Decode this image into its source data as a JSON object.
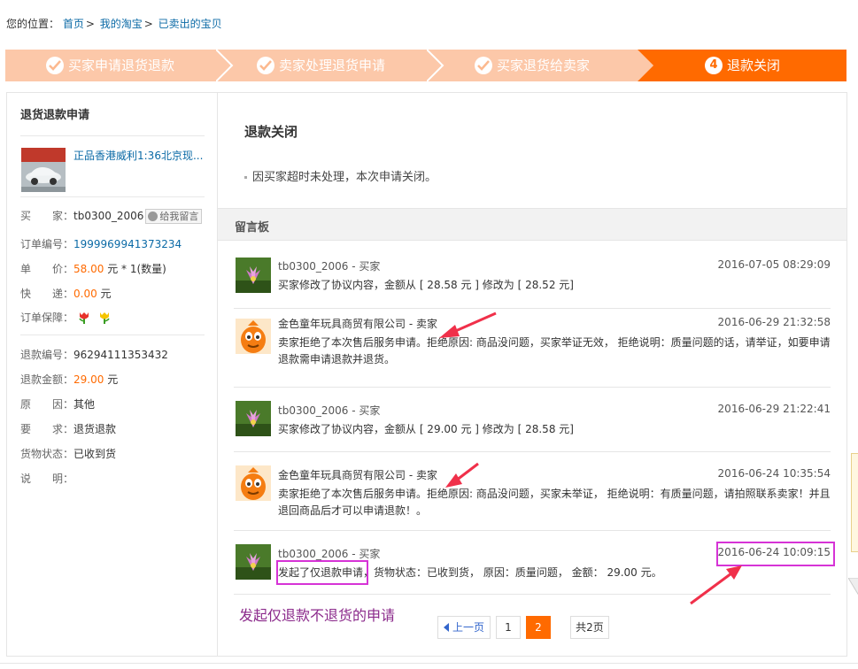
{
  "breadcrumb": {
    "prefix": "您的位置：",
    "items": [
      "首页",
      "我的淘宝",
      "已卖出的宝贝"
    ],
    "sep": ">"
  },
  "steps": [
    {
      "label": "买家申请退货退款",
      "state": "done"
    },
    {
      "label": "卖家处理退货申请",
      "state": "done"
    },
    {
      "label": "买家退货给卖家",
      "state": "done"
    },
    {
      "label": "退款关闭",
      "state": "current",
      "number": "4"
    }
  ],
  "colors": {
    "step_done": "#fcc8a9",
    "step_current": "#ff6a00",
    "accent": "#ff6a00",
    "annotation": "#d633d6"
  },
  "sidebar": {
    "title": "退货退款申请",
    "product_link": "正品香港威利1:36北京现...",
    "buyer_label": "买　　家：",
    "buyer": "tb0300_2006",
    "msg_button": "给我留言",
    "order_no_label": "订单编号：",
    "order_no": "1999969941373234",
    "price_label": "单　　价：",
    "price": "58.00",
    "price_suffix": "元 * 1(数量)",
    "shipping_label": "快　　递：",
    "shipping": "0.00",
    "shipping_suffix": "元",
    "guarantee_label": "订单保障：",
    "refund_no_label": "退款编号：",
    "refund_no": "96294111353432",
    "refund_amount_label": "退款金额：",
    "refund_amount": "29.00",
    "refund_amount_suffix": "元",
    "reason_label": "原　　因：",
    "reason": "其他",
    "request_label": "要　　求：",
    "request": "退货退款",
    "goods_status_label": "货物状态：",
    "goods_status": "已收到货",
    "note_label": "说　　明："
  },
  "status": {
    "title": "退款关闭",
    "note": "因买家超时未处理，本次申请关闭。"
  },
  "board": {
    "title": "留言板",
    "messages": [
      {
        "who": "tb0300_2006 - 买家",
        "time": "2016-07-05 08:29:09",
        "text": "买家修改了协议内容，金额从 [ 28.58 元 ] 修改为 [ 28.52 元]",
        "avatar": "lotus-avatar"
      },
      {
        "who": "金色童年玩具商贸有限公司 - 卖家",
        "time": "2016-06-29 21:32:58",
        "text": "卖家拒绝了本次售后服务申请。拒绝原因: 商品没问题，买家举证无效， 拒绝说明：质量问题的话，请举证，如要申请退款需申请退款并退货。",
        "avatar": "mascot-avatar"
      },
      {
        "who": "tb0300_2006 - 买家",
        "time": "2016-06-29 21:22:41",
        "text": "买家修改了协议内容，金额从 [ 29.00 元 ] 修改为 [ 28.58 元]",
        "avatar": "lotus-avatar"
      },
      {
        "who": "金色童年玩具商贸有限公司 - 卖家",
        "time": "2016-06-24 10:35:54",
        "text": "卖家拒绝了本次售后服务申请。拒绝原因: 商品没问题，买家未举证， 拒绝说明：有质量问题，请拍照联系卖家！并且退回商品后才可以申请退款！。",
        "avatar": "mascot-avatar"
      },
      {
        "who": "tb0300_2006 - 买家",
        "time": "2016-06-24 10:09:15",
        "text_highlight": "发起了仅退款申请",
        "text_rest": "，货物状态：已收到货， 原因：质量问题， 金额： 29.00 元。",
        "avatar": "lotus-avatar"
      }
    ]
  },
  "annotation_caption": "发起仅退款不退货的申请",
  "pagination": {
    "prev": "上一页",
    "pages": [
      "1",
      "2"
    ],
    "current": "2",
    "total": "共2页"
  }
}
